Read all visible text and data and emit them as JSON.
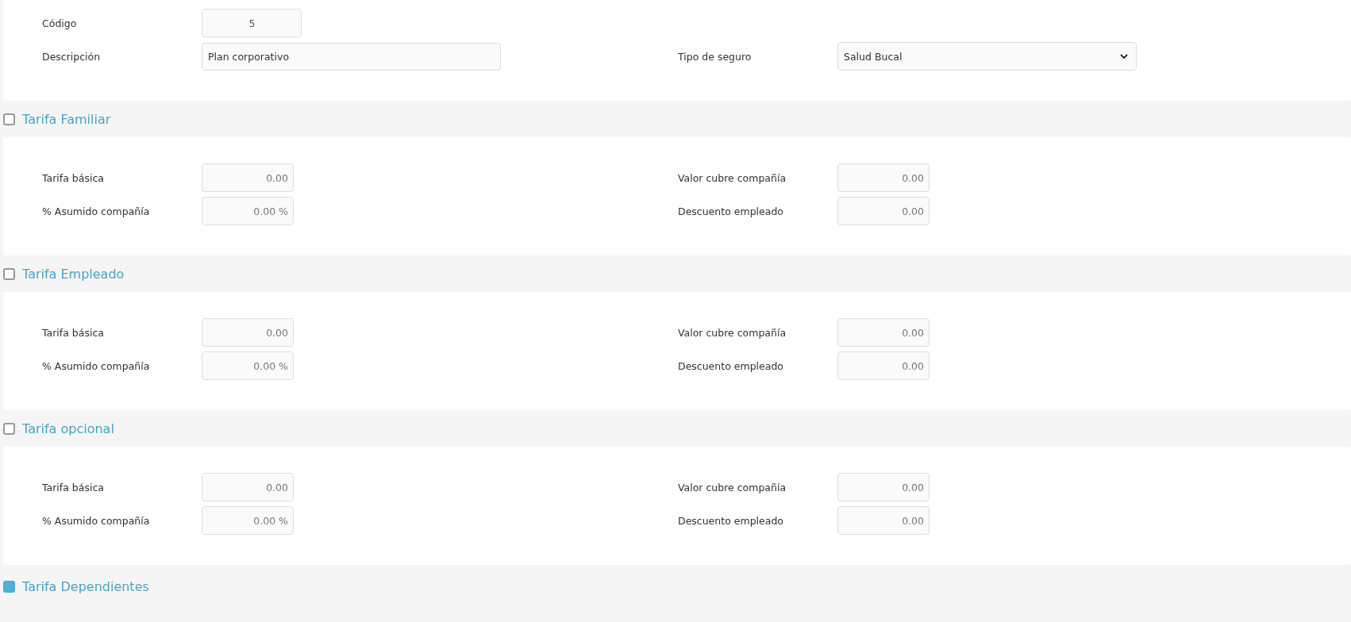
{
  "general": {
    "rows": [
      [
        {
          "label": "Código",
          "value": "5",
          "kind": "code"
        }
      ],
      [
        {
          "label": "Descripción",
          "value": "Plan corporativo",
          "kind": "text"
        },
        {
          "label": "Tipo de seguro",
          "value": "Salud Bucal",
          "kind": "select"
        }
      ]
    ]
  },
  "sections": [
    {
      "title": "Tarifa Familiar",
      "checked": false,
      "rows": [
        [
          {
            "label": "Tarifa básica",
            "value": "0.00",
            "kind": "amount"
          },
          {
            "label": "Valor cubre compañía",
            "value": "0.00",
            "kind": "amount"
          }
        ],
        [
          {
            "label": "% Asumido compañía",
            "value": "0.00 %",
            "kind": "amount"
          },
          {
            "label": "Descuento empleado",
            "value": "0.00",
            "kind": "amount"
          }
        ]
      ]
    },
    {
      "title": "Tarifa Empleado",
      "checked": false,
      "rows": [
        [
          {
            "label": "Tarifa básica",
            "value": "0.00",
            "kind": "amount"
          },
          {
            "label": "Valor cubre compañía",
            "value": "0.00",
            "kind": "amount"
          }
        ],
        [
          {
            "label": "% Asumido compañía",
            "value": "0.00 %",
            "kind": "amount"
          },
          {
            "label": "Descuento empleado",
            "value": "0.00",
            "kind": "amount"
          }
        ]
      ]
    },
    {
      "title": "Tarifa opcional",
      "checked": false,
      "rows": [
        [
          {
            "label": "Tarifa básica",
            "value": "0.00",
            "kind": "amount"
          },
          {
            "label": "Valor cubre compañía",
            "value": "0.00",
            "kind": "amount"
          }
        ],
        [
          {
            "label": "% Asumido compañía",
            "value": "0.00 %",
            "kind": "amount"
          },
          {
            "label": "Descuento empleado",
            "value": "0.00",
            "kind": "amount"
          }
        ]
      ]
    },
    {
      "title": "Tarifa Dependientes",
      "checked": true
    }
  ]
}
